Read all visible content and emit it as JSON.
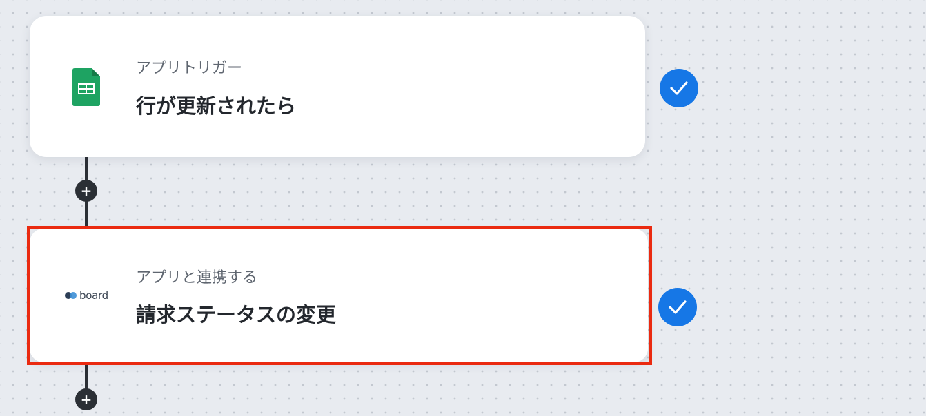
{
  "steps": [
    {
      "subtitle": "アプリトリガー",
      "title": "行が更新されたら",
      "app_icon": "google-sheets-icon",
      "status_icon": "check-icon",
      "status_color": "#1677e6"
    },
    {
      "subtitle": "アプリと連携する",
      "title": "請求ステータスの変更",
      "app_icon": "board-logo",
      "app_logo_text": "board",
      "status_icon": "check-icon",
      "status_color": "#1677e6",
      "selected": true,
      "selected_color": "#ea2a10"
    }
  ],
  "add_step_icon": "plus-icon",
  "colors": {
    "canvas": "#e8ebf0",
    "connector": "#2b2f35",
    "sheets_green": "#1ea362"
  }
}
